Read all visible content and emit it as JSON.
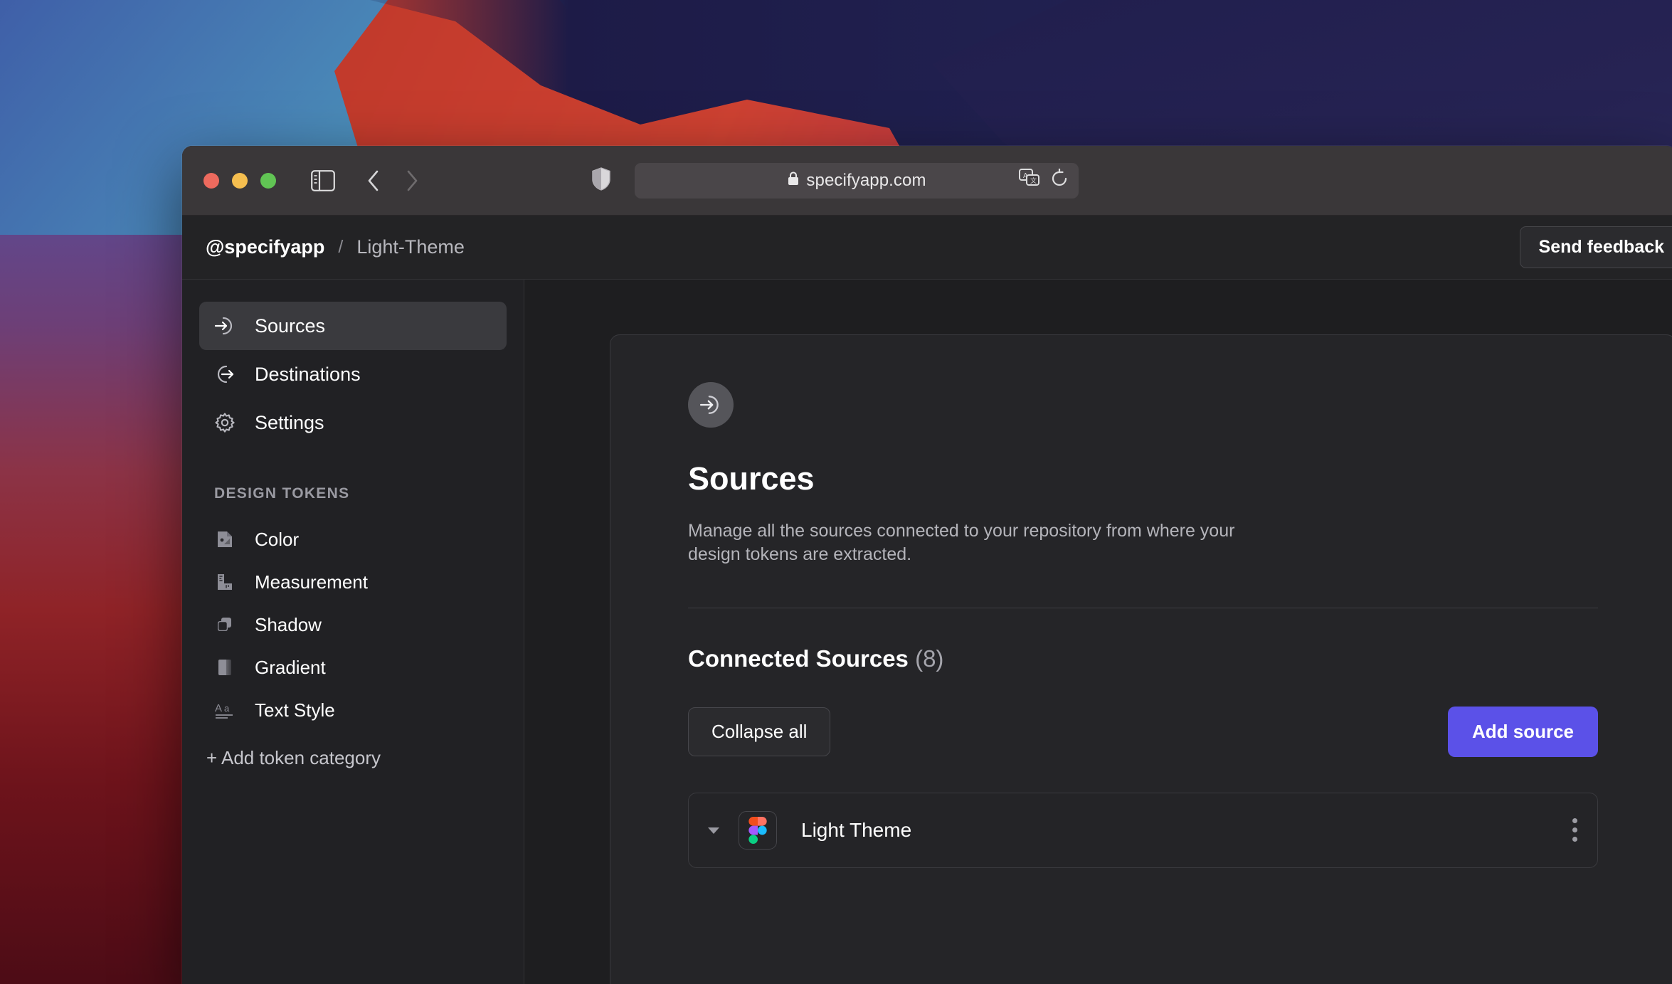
{
  "browser": {
    "traffic_lights": [
      "close",
      "minimize",
      "maximize"
    ],
    "sidebar_toggle_icon": "sidebar-toggle-icon",
    "back_icon": "chevron-left-icon",
    "forward_icon": "chevron-right-icon",
    "shield_icon": "privacy-shield-icon",
    "url": "specifyapp.com",
    "lock_icon": "lock-icon",
    "translate_icon": "translate-icon",
    "reload_icon": "reload-icon"
  },
  "header": {
    "org": "@specifyapp",
    "separator": "/",
    "project": "Light-Theme",
    "send_feedback_label": "Send feedback"
  },
  "sidebar": {
    "nav": [
      {
        "label": "Sources",
        "icon": "sources-arrow-in-icon",
        "active": true
      },
      {
        "label": "Destinations",
        "icon": "destinations-arrow-out-icon",
        "active": false
      },
      {
        "label": "Settings",
        "icon": "gear-icon",
        "active": false
      }
    ],
    "section_label": "DESIGN TOKENS",
    "tokens": [
      {
        "label": "Color",
        "icon": "color-swatch-icon"
      },
      {
        "label": "Measurement",
        "icon": "ruler-icon"
      },
      {
        "label": "Shadow",
        "icon": "shadow-square-icon"
      },
      {
        "label": "Gradient",
        "icon": "gradient-icon"
      },
      {
        "label": "Text Style",
        "icon": "text-style-icon"
      }
    ],
    "add_token_label": "+ Add token category"
  },
  "main": {
    "badge_icon": "sources-arrow-in-icon",
    "title": "Sources",
    "description": "Manage all the sources connected to your repository from where your design tokens are extracted.",
    "connected_title": "Connected Sources",
    "connected_count": "(8)",
    "collapse_all_label": "Collapse all",
    "add_source_label": "Add source",
    "sources": [
      {
        "name": "Light Theme",
        "logo": "figma-logo-icon",
        "caret": "caret-down-icon",
        "menu": "kebab-menu-icon"
      }
    ]
  },
  "colors": {
    "accent": "#5b51e8",
    "window_bg": "#1e1e20",
    "sidebar_bg": "#212124",
    "card_bg": "#252528",
    "chrome_bg": "#3a3739",
    "traffic_red": "#ed6a5e",
    "traffic_yellow": "#f5be4f",
    "traffic_green": "#61c454"
  }
}
